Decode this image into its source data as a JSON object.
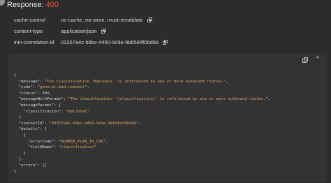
{
  "response": {
    "label": "Response:",
    "status_code": "400"
  },
  "headers": [
    {
      "name": "cache-control",
      "value": "no-cache, no-store, must-revalidate",
      "copyable": true
    },
    {
      "name": "content-type",
      "value": "application/json",
      "copyable": true
    },
    {
      "name": "inin-correlation-id",
      "value": "03357a4c-b9bc-4450-9c9e-9b6584f06d6b",
      "copyable": true
    }
  ],
  "body_panel": {
    "icons": [
      "copy-icon",
      "chevron-up-icon"
    ],
    "json": {
      "message": "The classification 'National' is referenced by one or more outbound routes.",
      "code": "general.bad.request",
      "status": "400",
      "messageWithParams": "The classification '{classification}' is referenced by one or more outbound routes.",
      "messageParams_classification": "National",
      "contextId": "03357a4c-b9bc-4450-9c9e-9b6584f06d6b",
      "details_errorCode": "NUMBER_PLAN_IN_USE",
      "details_fieldName": "classification",
      "errors": "[]"
    }
  },
  "colors": {
    "background": "#2c2c2c",
    "panel": "#333333",
    "status_error": "#e4572e",
    "string_value": "#e0a35e"
  }
}
